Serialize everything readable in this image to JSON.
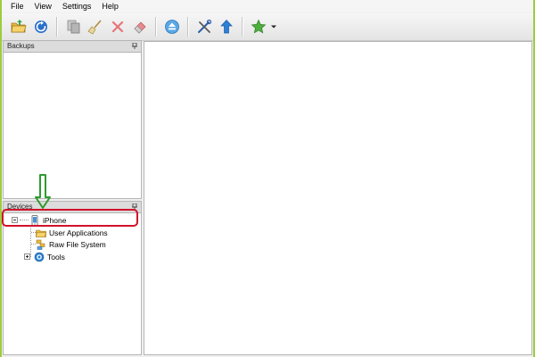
{
  "menubar": {
    "items": [
      "File",
      "View",
      "Settings",
      "Help"
    ]
  },
  "toolbar": {
    "buttons": [
      {
        "icon": "open-folder-icon"
      },
      {
        "icon": "refresh-icon"
      },
      {
        "icon": "copy-icon"
      },
      {
        "icon": "broom-icon"
      },
      {
        "icon": "delete-icon"
      },
      {
        "icon": "eraser-icon"
      },
      {
        "icon": "eject-icon"
      },
      {
        "icon": "tools-icon"
      },
      {
        "icon": "upload-arrow-icon"
      },
      {
        "icon": "star-icon"
      },
      {
        "icon": "dropdown-arrow-icon"
      }
    ]
  },
  "backups": {
    "title": "Backups"
  },
  "devices": {
    "title": "Devices",
    "tree": {
      "device": {
        "label": "iPhone",
        "icon": "iphone-icon",
        "expanded": true
      },
      "children": [
        {
          "label": "User Applications",
          "icon": "folder-icon"
        },
        {
          "label": "Raw File System",
          "icon": "file-system-icon"
        },
        {
          "label": "Tools",
          "icon": "tools-gear-icon",
          "expanded": false
        }
      ]
    }
  },
  "colors": {
    "frame_accent": "#9ccd3e",
    "annotation_red": "#d1112a",
    "annotation_green": "#2e9b2e",
    "panel_header": "#dcdcdc"
  }
}
